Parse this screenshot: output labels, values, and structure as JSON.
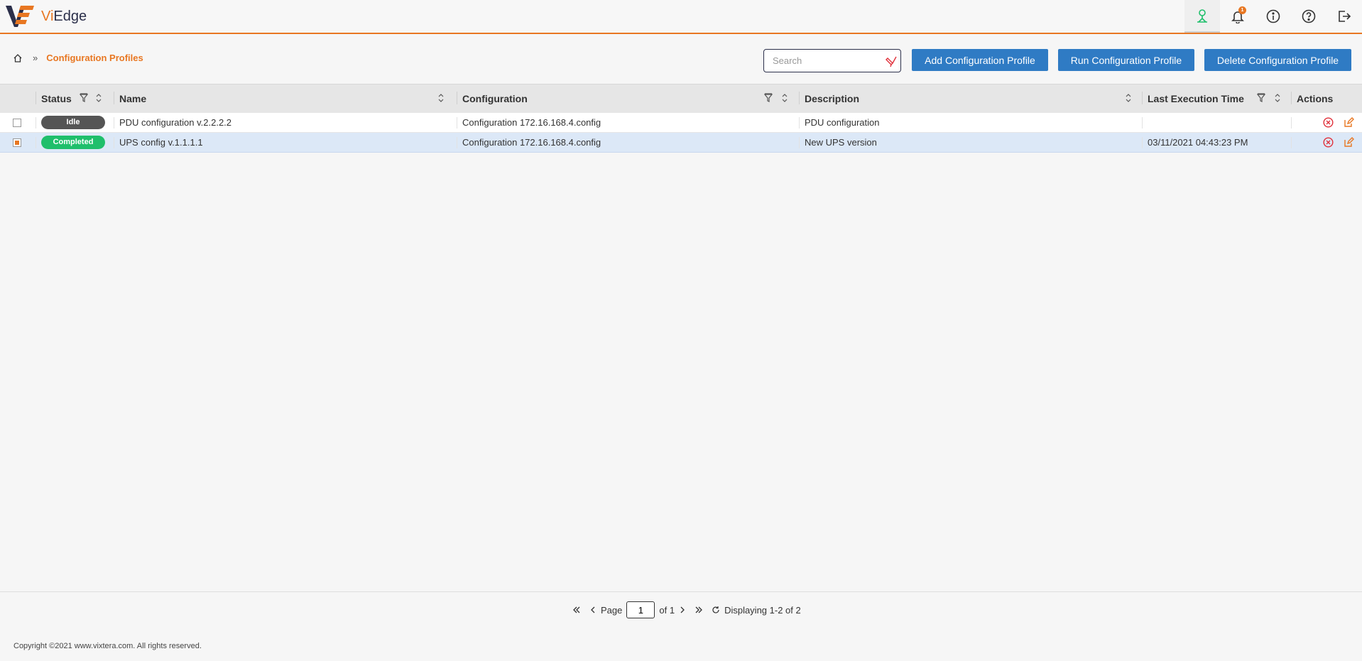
{
  "app": {
    "brand_prefix": "Vi",
    "brand_suffix": "Edge"
  },
  "header": {
    "icons": [
      {
        "name": "network-icon",
        "active": true
      },
      {
        "name": "bell-icon",
        "badge": "1"
      },
      {
        "name": "info-icon"
      },
      {
        "name": "help-icon"
      },
      {
        "name": "logout-icon"
      }
    ]
  },
  "breadcrumb": {
    "separator": "»",
    "current": "Configuration Profiles"
  },
  "search": {
    "placeholder": "Search",
    "value": ""
  },
  "toolbar": {
    "add_label": "Add Configuration Profile",
    "run_label": "Run Configuration Profile",
    "delete_label": "Delete Configuration Profile"
  },
  "table": {
    "columns": {
      "status": "Status",
      "name": "Name",
      "configuration": "Configuration",
      "description": "Description",
      "last_execution": "Last Execution Time",
      "actions": "Actions"
    },
    "rows": [
      {
        "selected": false,
        "status": "Idle",
        "name": "PDU configuration v.2.2.2.2",
        "configuration": "Configuration 172.16.168.4.config",
        "description": "PDU configuration",
        "last_execution": ""
      },
      {
        "selected": true,
        "status": "Completed",
        "name": "UPS config v.1.1.1.1",
        "configuration": "Configuration 172.16.168.4.config",
        "description": "New UPS version",
        "last_execution": "03/11/2021 04:43:23 PM"
      }
    ]
  },
  "pager": {
    "page_label": "Page",
    "page_value": "1",
    "of_label": "of 1",
    "display_text": "Displaying 1-2 of 2"
  },
  "footer": {
    "copyright": "Copyright ©2021 www.vixtera.com. All rights reserved."
  },
  "colors": {
    "accent": "#e87722",
    "primary": "#2f7bc4",
    "idle": "#555555",
    "completed": "#1fbf6b",
    "danger": "#e0303a"
  }
}
